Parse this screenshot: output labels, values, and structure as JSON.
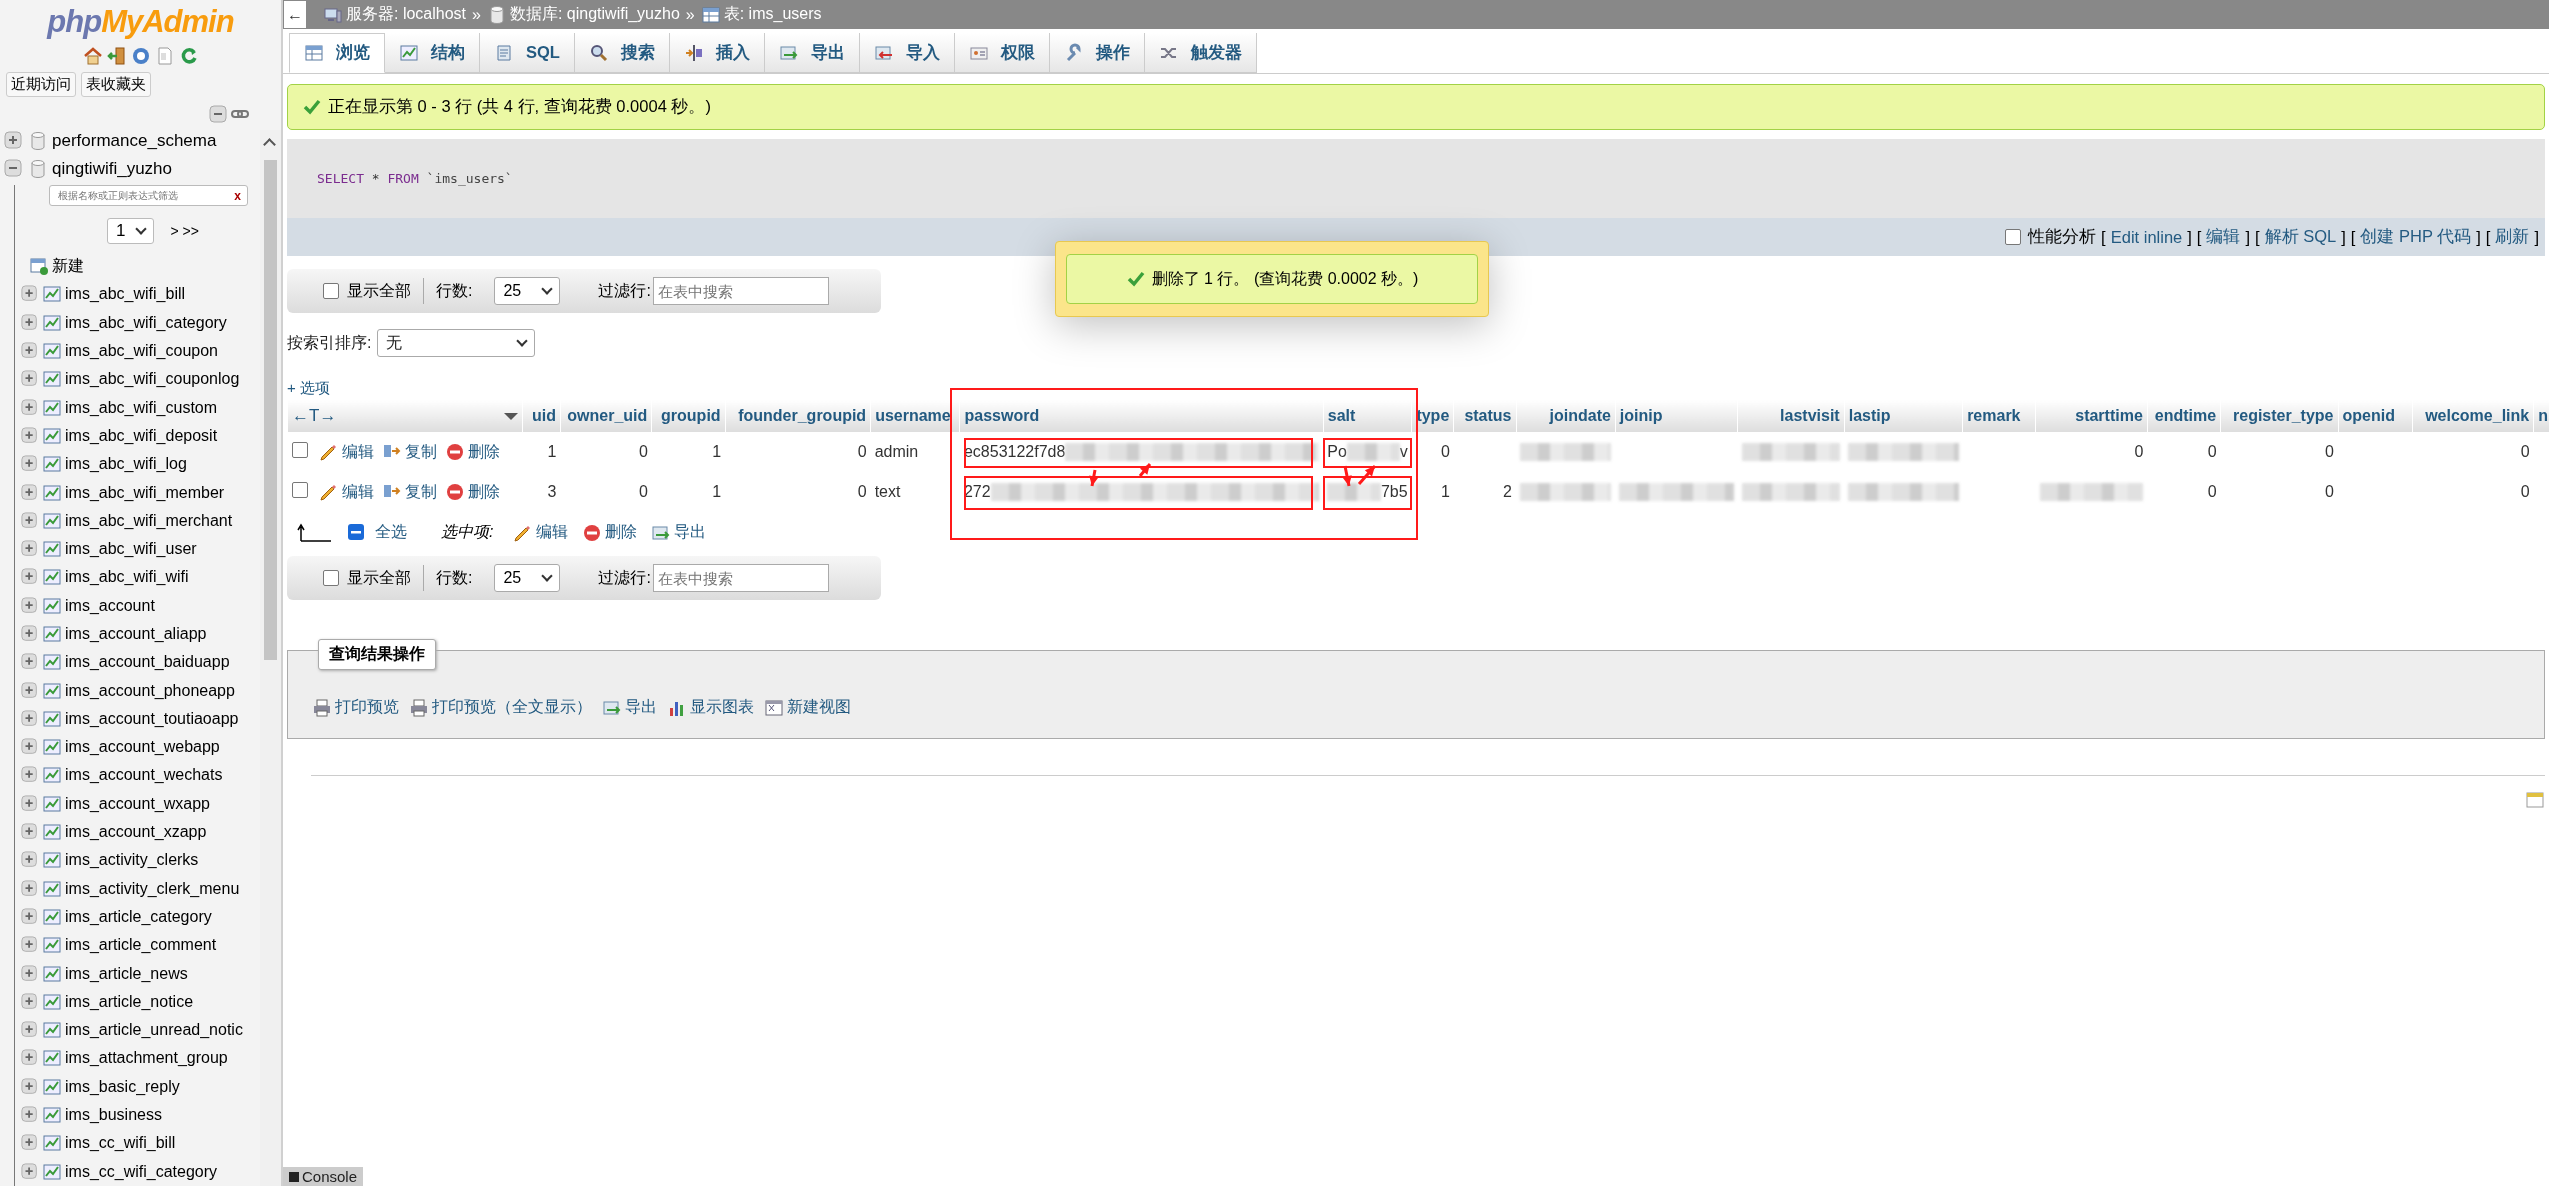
{
  "sidebar": {
    "logo": [
      "php",
      "MyAdmin"
    ],
    "buttons": [
      "近期访问",
      "表收藏夹"
    ],
    "databases": [
      {
        "name": "performance_schema",
        "expanded": false
      },
      {
        "name": "qingtiwifi_yuzho",
        "expanded": true,
        "filter_placeholder": "根据名称或正则表达式筛选",
        "clear": "x",
        "page": "1",
        "pager": "> >>",
        "new_label": "新建",
        "tables": [
          "ims_abc_wifi_bill",
          "ims_abc_wifi_category",
          "ims_abc_wifi_coupon",
          "ims_abc_wifi_couponlog",
          "ims_abc_wifi_custom",
          "ims_abc_wifi_deposit",
          "ims_abc_wifi_log",
          "ims_abc_wifi_member",
          "ims_abc_wifi_merchant",
          "ims_abc_wifi_user",
          "ims_abc_wifi_wifi",
          "ims_account",
          "ims_account_aliapp",
          "ims_account_baiduapp",
          "ims_account_phoneapp",
          "ims_account_toutiaoapp",
          "ims_account_webapp",
          "ims_account_wechats",
          "ims_account_wxapp",
          "ims_account_xzapp",
          "ims_activity_clerks",
          "ims_activity_clerk_menu",
          "ims_article_category",
          "ims_article_comment",
          "ims_article_news",
          "ims_article_notice",
          "ims_article_unread_notic",
          "ims_attachment_group",
          "ims_basic_reply",
          "ims_business",
          "ims_cc_wifi_bill",
          "ims_cc_wifi_category"
        ]
      }
    ]
  },
  "breadcrumb": {
    "back": "←",
    "items": [
      {
        "label": "服务器: localhost",
        "kind": "server"
      },
      {
        "label": "数据库: qingtiwifi_yuzho",
        "kind": "database"
      },
      {
        "label": "表: ims_users",
        "kind": "table"
      }
    ],
    "separator": "»"
  },
  "tabs": [
    {
      "label": "浏览",
      "kind": "browse",
      "selected": true
    },
    {
      "label": "结构",
      "kind": "structure",
      "selected": false
    },
    {
      "label": "SQL",
      "kind": "sql",
      "selected": false
    },
    {
      "label": "搜索",
      "kind": "search",
      "selected": false
    },
    {
      "label": "插入",
      "kind": "insert",
      "selected": false
    },
    {
      "label": "导出",
      "kind": "export",
      "selected": false
    },
    {
      "label": "导入",
      "kind": "import",
      "selected": false
    },
    {
      "label": "权限",
      "kind": "privileges",
      "selected": false
    },
    {
      "label": "操作",
      "kind": "operations",
      "selected": false
    },
    {
      "label": "触发器",
      "kind": "triggers",
      "selected": false
    }
  ],
  "success_message": "正在显示第 0 - 3 行 (共 4 行, 查询花费 0.0004 秒。)",
  "sql": [
    {
      "text": "SELECT",
      "kind": "keyword"
    },
    {
      "text": " * ",
      "kind": "plain"
    },
    {
      "text": "FROM",
      "kind": "keyword"
    },
    {
      "text": " `ims_users`",
      "kind": "name"
    }
  ],
  "query_links": {
    "profiling": {
      "label": "性能分析",
      "checked": false
    },
    "links": [
      {
        "open": "[",
        "label": "Edit inline",
        "close": "]"
      },
      {
        "open": "[",
        "label": "编辑",
        "close": "]"
      },
      {
        "open": "[",
        "label": "解析 SQL",
        "close": "]"
      },
      {
        "open": "[",
        "label": "创建 PHP 代码",
        "close": "]"
      },
      {
        "open": "[",
        "label": "刷新",
        "close": "]"
      }
    ]
  },
  "notification": "删除了 1 行。 (查询花费 0.0002 秒。)",
  "nav_bars": [
    {
      "show_all": {
        "label": "显示全部",
        "checked": false
      },
      "rows_label": "行数:",
      "rows_value": "25",
      "filter_label": "过滤行:",
      "filter_placeholder": "在表中搜索"
    },
    {
      "show_all": {
        "label": "显示全部",
        "checked": false
      },
      "rows_label": "行数:",
      "rows_value": "25",
      "filter_label": "过滤行:",
      "filter_placeholder": "在表中搜索"
    }
  ],
  "sort": {
    "label": "按索引排序:",
    "value": "无"
  },
  "options_link": "+ 选项",
  "table": {
    "arrows": "←T→",
    "columns": [
      {
        "name": "uid",
        "kind": "number"
      },
      {
        "name": "owner_uid",
        "kind": "number"
      },
      {
        "name": "groupid",
        "kind": "number"
      },
      {
        "name": "founder_groupid",
        "kind": "number"
      },
      {
        "name": "username",
        "kind": "text"
      },
      {
        "name": "password",
        "kind": "text"
      },
      {
        "name": "salt",
        "kind": "text"
      },
      {
        "name": "type",
        "kind": "number"
      },
      {
        "name": "status",
        "kind": "number"
      },
      {
        "name": "joindate",
        "kind": "number"
      },
      {
        "name": "joinip",
        "kind": "text"
      },
      {
        "name": "lastvisit",
        "kind": "number"
      },
      {
        "name": "lastip",
        "kind": "text"
      },
      {
        "name": "remark",
        "kind": "text"
      },
      {
        "name": "starttime",
        "kind": "number"
      },
      {
        "name": "endtime",
        "kind": "number"
      },
      {
        "name": "register_type",
        "kind": "number"
      },
      {
        "name": "openid",
        "kind": "text"
      },
      {
        "name": "welcome_link",
        "kind": "number"
      },
      {
        "name": "n",
        "kind": "text"
      }
    ],
    "rows": [
      {
        "checked": false,
        "actions": [
          "编辑",
          "复制",
          "删除"
        ],
        "cells": [
          {
            "text": "1"
          },
          {
            "text": "0"
          },
          {
            "text": "1"
          },
          {
            "text": "0"
          },
          {
            "text": "admin"
          },
          {
            "text": "ec853122f7d8",
            "blur": true
          },
          {
            "text": "Po",
            "blur": true,
            "tail": "v"
          },
          {
            "text": "0"
          },
          {},
          {
            "blur": true
          },
          {},
          {
            "blur": true
          },
          {
            "blur": true
          },
          {},
          {
            "text": "0"
          },
          {
            "text": "0"
          },
          {
            "text": "0"
          },
          {},
          {
            "text": "0"
          },
          {}
        ]
      },
      {
        "checked": false,
        "actions": [
          "编辑",
          "复制",
          "删除"
        ],
        "cells": [
          {
            "text": "3"
          },
          {
            "text": "0"
          },
          {
            "text": "1"
          },
          {
            "text": "0"
          },
          {
            "text": "text"
          },
          {
            "text": "272",
            "blur": true
          },
          {
            "blur": true,
            "tail": "7b5"
          },
          {
            "text": "1"
          },
          {
            "text": "2"
          },
          {
            "blur": true
          },
          {
            "blur": true
          },
          {
            "blur": true
          },
          {
            "blur": true
          },
          {},
          {
            "blur": true
          },
          {
            "text": "0"
          },
          {
            "text": "0"
          },
          {},
          {
            "text": "0"
          },
          {}
        ]
      }
    ]
  },
  "bulk": {
    "check_all": "全选",
    "with_selected": "选中项:",
    "actions": [
      {
        "label": "编辑",
        "kind": "edit"
      },
      {
        "label": "删除",
        "kind": "delete"
      },
      {
        "label": "导出",
        "kind": "export"
      }
    ]
  },
  "query_ops": {
    "legend": "查询结果操作",
    "actions": [
      {
        "label": "打印预览",
        "kind": "print"
      },
      {
        "label": "打印预览（全文显示）",
        "kind": "print"
      },
      {
        "label": "导出",
        "kind": "export"
      },
      {
        "label": "显示图表",
        "kind": "chart"
      },
      {
        "label": "新建视图",
        "kind": "view"
      }
    ]
  },
  "console": "Console"
}
